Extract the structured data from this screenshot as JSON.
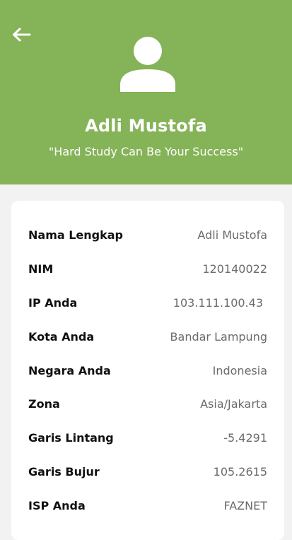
{
  "header": {
    "name": "Adli Mustofa",
    "quote": "\"Hard Study Can Be Your Success\"",
    "back_icon": "arrow-left-icon",
    "avatar_icon": "person-icon",
    "background_color": "#85b358"
  },
  "details": [
    {
      "label": "Nama Lengkap",
      "value": "Adli Mustofa"
    },
    {
      "label": "NIM",
      "value": "120140022"
    },
    {
      "label": "IP Anda",
      "value": "103.111.100.43"
    },
    {
      "label": "Kota Anda",
      "value": "Bandar Lampung"
    },
    {
      "label": "Negara Anda",
      "value": "Indonesia"
    },
    {
      "label": "Zona",
      "value": "Asia/Jakarta"
    },
    {
      "label": "Garis Lintang",
      "value": "-5.4291"
    },
    {
      "label": "Garis Bujur",
      "value": "105.2615"
    },
    {
      "label": "ISP Anda",
      "value": "FAZNET"
    }
  ]
}
